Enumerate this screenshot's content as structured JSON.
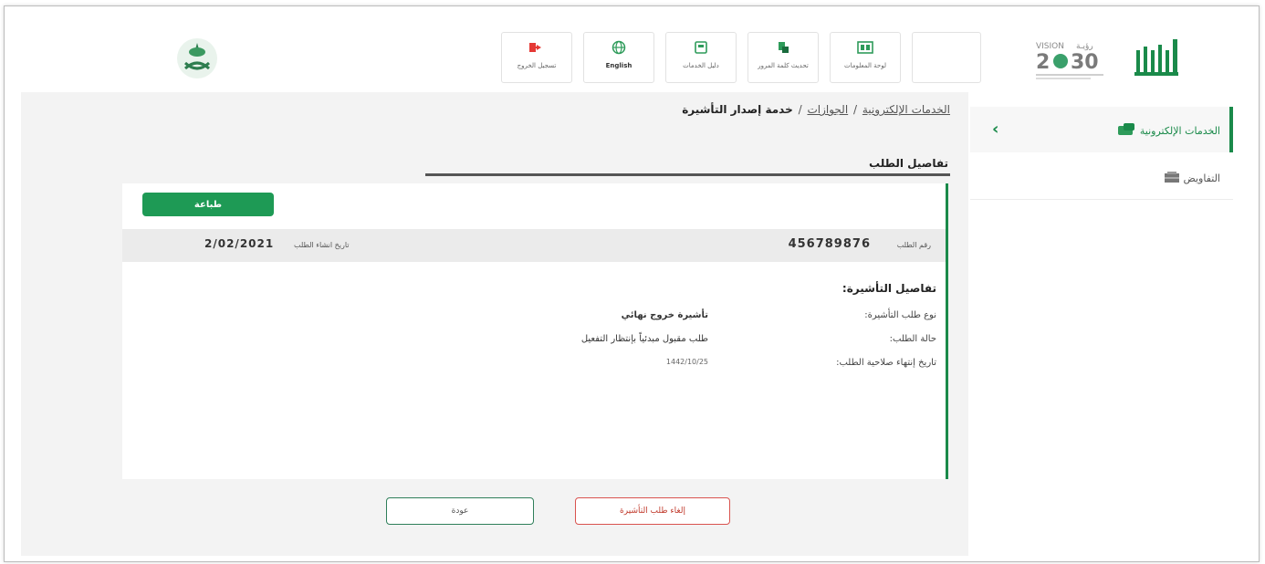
{
  "header": {
    "toolbar": [
      {
        "icon": "logout-icon",
        "label": "تسجيل الخروج"
      },
      {
        "icon": "globe-icon",
        "label": "English"
      },
      {
        "icon": "services-guide-icon",
        "label": "دليل الخدمات"
      },
      {
        "icon": "update-info-icon",
        "label": "تحديث كلمة المرور"
      },
      {
        "icon": "dashboard-icon",
        "label": "لوحة المعلومات"
      }
    ]
  },
  "breadcrumb": {
    "root": "الخدمات الإلكترونية",
    "sep1": "/",
    "parent": "الجوازات",
    "sep2": "/",
    "current": "خدمة إصدار التأشيرة"
  },
  "section": {
    "title": "تفاصيل الطلب"
  },
  "card": {
    "print_label": "طباعة",
    "request_number_label": "رقم الطلب",
    "request_number": "456789876",
    "created_date_label": "تاريخ انشاء الطلب",
    "created_date": "2/02/2021",
    "details_title": "تفاصيل التأشيرة:",
    "rows": [
      {
        "label": "نوع طلب التأشيرة:",
        "value": "تأشيرة خروج نهائي"
      },
      {
        "label": "حالة الطلب:",
        "value": "طلب مقبول مبدئياً بإنتظار التفعيل"
      },
      {
        "label": "تاريخ إنتهاء صلاحية الطلب:",
        "value": "1442/10/25"
      }
    ]
  },
  "actions": {
    "back_label": "عودة",
    "cancel_label": "إلغاء طلب التأشيرة"
  },
  "sidebar": {
    "items": [
      {
        "label": "الخدمات الإلكترونية",
        "icon": "services-icon",
        "active": true
      },
      {
        "label": "التفاويض",
        "icon": "delegation-icon",
        "active": false
      }
    ]
  },
  "colors": {
    "accent": "#1a8a4a",
    "print_button": "#1e9a55",
    "cancel": "#d9534f"
  }
}
